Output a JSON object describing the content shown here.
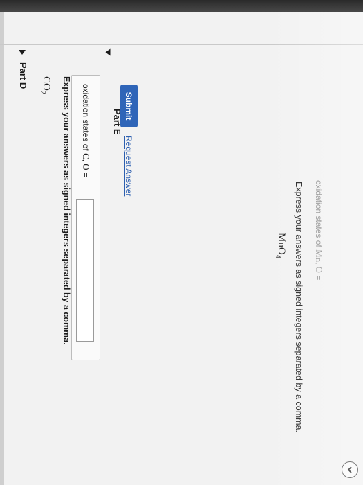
{
  "part_d": {
    "title": "Part D",
    "formula_main": "CO",
    "formula_sub": "2",
    "instructions": "Express your answers as signed integers separated by a comma.",
    "field_label_prefix": "oxidation states of ",
    "field_label_math": "C, O",
    "field_label_suffix": " =",
    "input_value": "",
    "submit_label": "Submit",
    "request_answer_label": "Request Answer"
  },
  "part_e": {
    "title": "Part E",
    "formula_main": "MnO",
    "formula_sub": "4",
    "instructions": "Express your answers as signed integers separated by a comma.",
    "field_label_prefix": "oxidation states of ",
    "field_label_math": "Mn, O",
    "field_label_suffix": " ="
  },
  "nav": {
    "icon": "chevron-left-icon"
  }
}
